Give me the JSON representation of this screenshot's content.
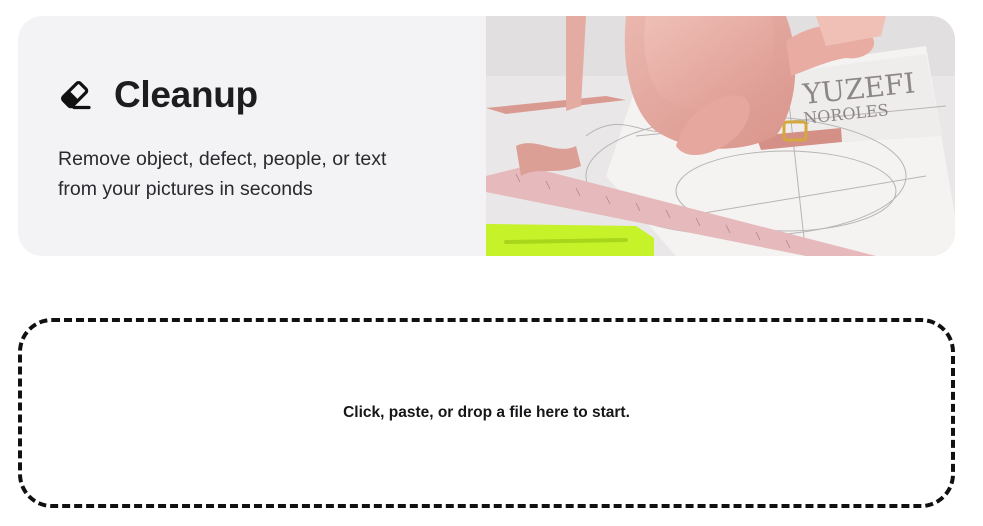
{
  "hero": {
    "icon": "eraser-icon",
    "title": "Cleanup",
    "subtitle_line1": "Remove object, defect, people, or text",
    "subtitle_line2": "from your pictures in seconds",
    "image_alt": "pink leather handbag on a design sketch with a ruler",
    "image_brand_text_line1": "YUZEFI",
    "image_brand_text_line2": "NOROLES"
  },
  "dropzone": {
    "label": "Click, paste, or drop a file here to start."
  },
  "colors": {
    "hero_background": "#f3f3f5",
    "text_primary": "#1d1d20",
    "dropzone_border": "#111111",
    "bag_pink": "#e3a89f",
    "highlighter_green": "#c6f22a"
  }
}
